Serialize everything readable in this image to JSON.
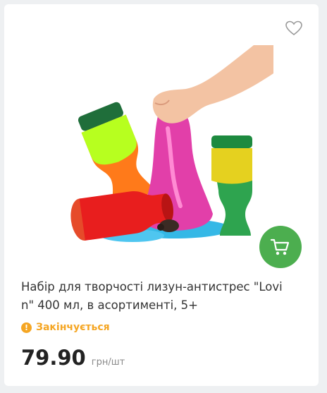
{
  "product": {
    "title": "Набір для творчості лизун-антистрес \"Lovi\nn\" 400 мл, в асортименті, 5+",
    "stock_icon": "!",
    "stock_status": "Закінчується",
    "price": "79.90",
    "price_unit": "грн/шт",
    "image_icon": "slime-toy-image",
    "favorite_icon": "heart-outline-icon",
    "cart_icon": "cart-icon"
  },
  "colors": {
    "cart_button": "#4cae4f",
    "stock_warning": "#f5a623",
    "text": "#333333"
  }
}
